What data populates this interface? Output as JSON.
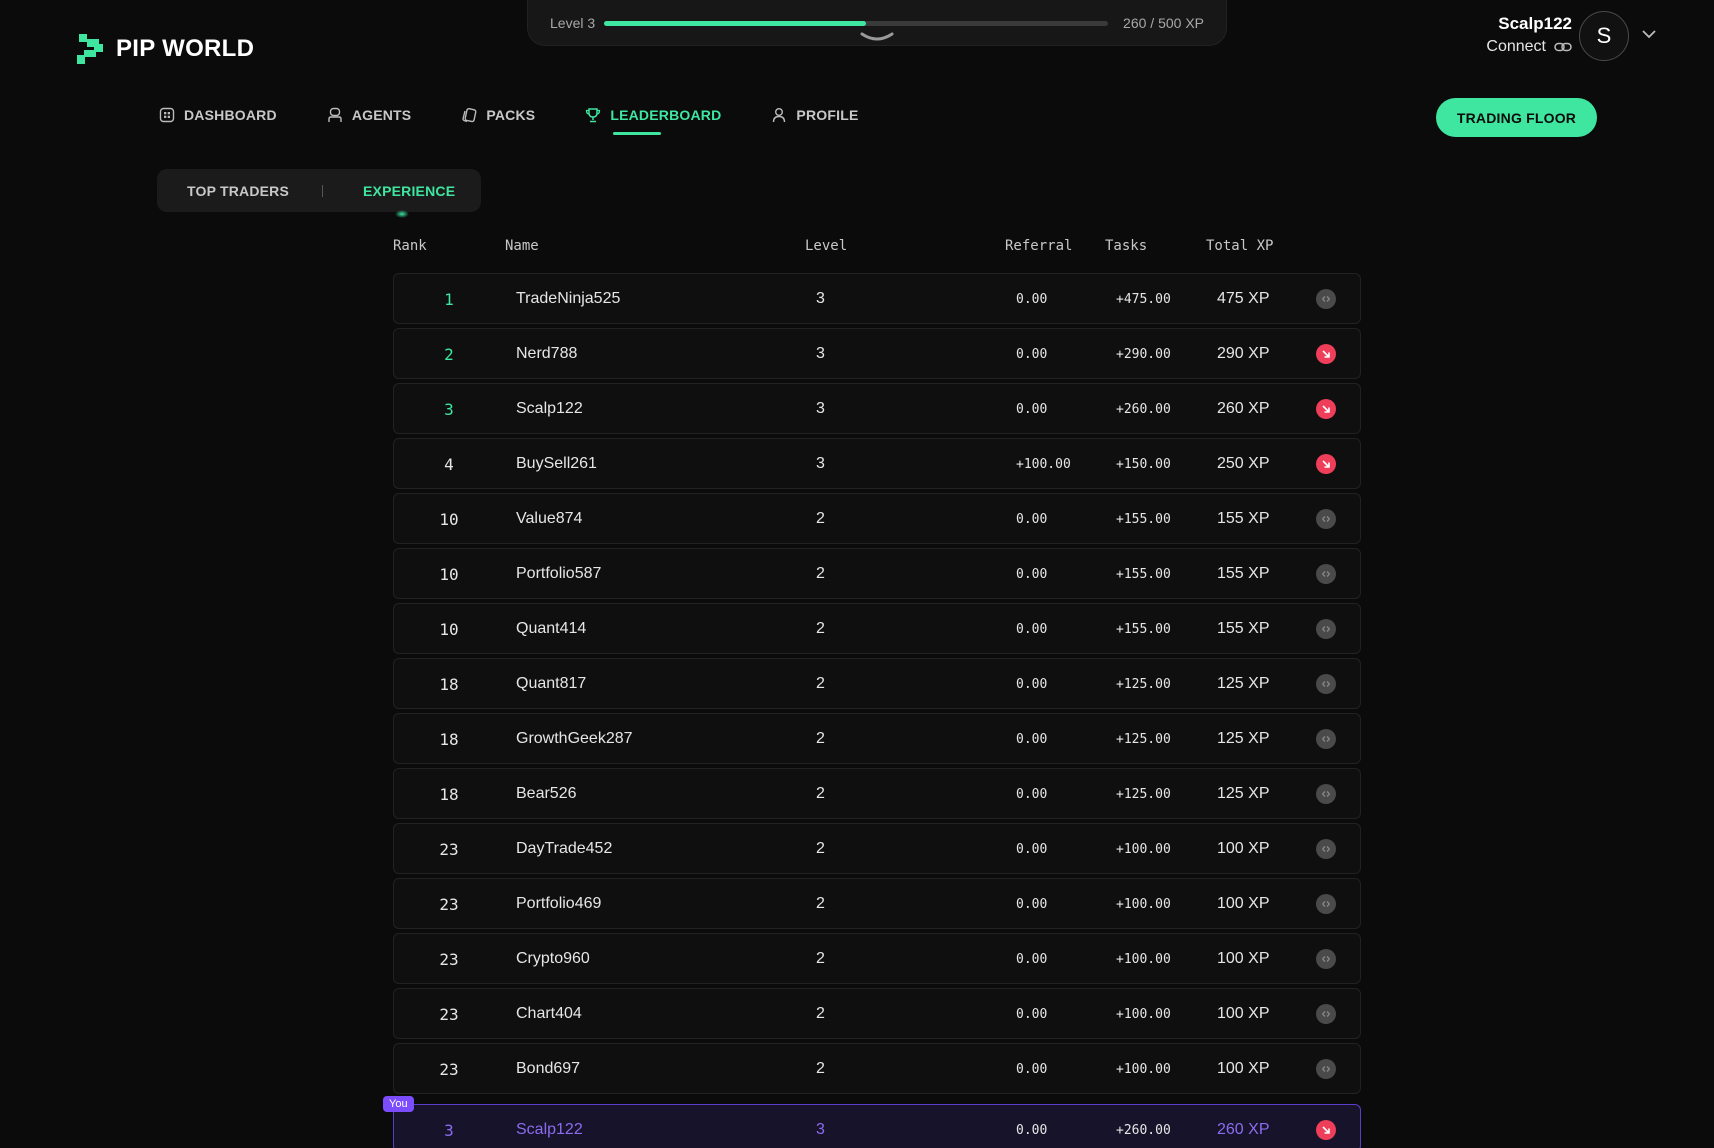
{
  "xp": {
    "level_label": "Level 3",
    "progress_text": "260 / 500 XP",
    "progress_fraction": 0.52
  },
  "brand": {
    "name": "PIP WORLD",
    "accent": "#3ee6a0"
  },
  "user": {
    "name": "Scalp122",
    "connect_label": "Connect",
    "avatar_letter": "S"
  },
  "nav": {
    "items": [
      {
        "label": "DASHBOARD",
        "icon": "dashboard-icon"
      },
      {
        "label": "AGENTS",
        "icon": "agents-icon"
      },
      {
        "label": "PACKS",
        "icon": "packs-icon"
      },
      {
        "label": "LEADERBOARD",
        "icon": "trophy-icon",
        "active": true
      },
      {
        "label": "PROFILE",
        "icon": "user-icon"
      }
    ],
    "cta_label": "TRADING FLOOR"
  },
  "subtabs": {
    "top_traders": "TOP TRADERS",
    "experience": "EXPERIENCE"
  },
  "table": {
    "headers": {
      "rank": "Rank",
      "name": "Name",
      "level": "Level",
      "referral": "Referral",
      "tasks": "Tasks",
      "total": "Total XP"
    },
    "rows": [
      {
        "rank": "1",
        "name": "TradeNinja525",
        "level": "3",
        "referral": "0.00",
        "tasks": "+475.00",
        "total": "475 XP",
        "trend": "neutral"
      },
      {
        "rank": "2",
        "name": "Nerd788",
        "level": "3",
        "referral": "0.00",
        "tasks": "+290.00",
        "total": "290 XP",
        "trend": "down"
      },
      {
        "rank": "3",
        "name": "Scalp122",
        "level": "3",
        "referral": "0.00",
        "tasks": "+260.00",
        "total": "260 XP",
        "trend": "down"
      },
      {
        "rank": "4",
        "name": "BuySell261",
        "level": "3",
        "referral": "+100.00",
        "tasks": "+150.00",
        "total": "250 XP",
        "trend": "down"
      },
      {
        "rank": "10",
        "name": "Value874",
        "level": "2",
        "referral": "0.00",
        "tasks": "+155.00",
        "total": "155 XP",
        "trend": "neutral"
      },
      {
        "rank": "10",
        "name": "Portfolio587",
        "level": "2",
        "referral": "0.00",
        "tasks": "+155.00",
        "total": "155 XP",
        "trend": "neutral"
      },
      {
        "rank": "10",
        "name": "Quant414",
        "level": "2",
        "referral": "0.00",
        "tasks": "+155.00",
        "total": "155 XP",
        "trend": "neutral"
      },
      {
        "rank": "18",
        "name": "Quant817",
        "level": "2",
        "referral": "0.00",
        "tasks": "+125.00",
        "total": "125 XP",
        "trend": "neutral"
      },
      {
        "rank": "18",
        "name": "GrowthGeek287",
        "level": "2",
        "referral": "0.00",
        "tasks": "+125.00",
        "total": "125 XP",
        "trend": "neutral"
      },
      {
        "rank": "18",
        "name": "Bear526",
        "level": "2",
        "referral": "0.00",
        "tasks": "+125.00",
        "total": "125 XP",
        "trend": "neutral"
      },
      {
        "rank": "23",
        "name": "DayTrade452",
        "level": "2",
        "referral": "0.00",
        "tasks": "+100.00",
        "total": "100 XP",
        "trend": "neutral"
      },
      {
        "rank": "23",
        "name": "Portfolio469",
        "level": "2",
        "referral": "0.00",
        "tasks": "+100.00",
        "total": "100 XP",
        "trend": "neutral"
      },
      {
        "rank": "23",
        "name": "Crypto960",
        "level": "2",
        "referral": "0.00",
        "tasks": "+100.00",
        "total": "100 XP",
        "trend": "neutral"
      },
      {
        "rank": "23",
        "name": "Chart404",
        "level": "2",
        "referral": "0.00",
        "tasks": "+100.00",
        "total": "100 XP",
        "trend": "neutral"
      },
      {
        "rank": "23",
        "name": "Bond697",
        "level": "2",
        "referral": "0.00",
        "tasks": "+100.00",
        "total": "100 XP",
        "trend": "neutral"
      }
    ],
    "me": {
      "badge": "You",
      "rank": "3",
      "name": "Scalp122",
      "level": "3",
      "referral": "0.00",
      "tasks": "+260.00",
      "total": "260 XP",
      "trend": "down"
    }
  }
}
